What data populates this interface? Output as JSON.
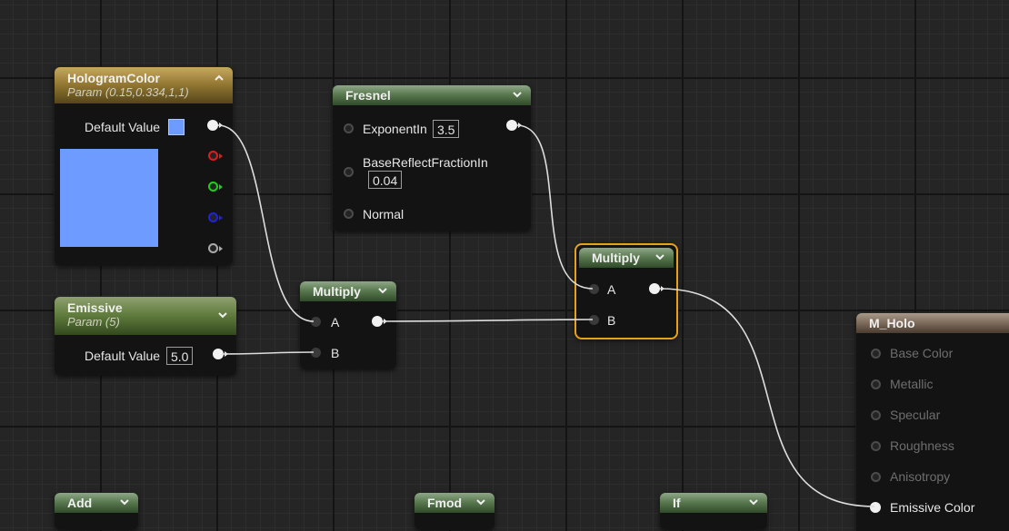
{
  "nodes": {
    "hologram_color": {
      "title": "HologramColor",
      "subtitle": "Param (0.15,0.334,1,1)",
      "default_label": "Default Value",
      "swatch_color": "#6e9bff",
      "channel_colors": [
        "#f2f2f2",
        "#e01c1c",
        "#1cd11c",
        "#2222dd",
        "#aaaaaa"
      ]
    },
    "emissive": {
      "title": "Emissive",
      "subtitle": "Param (5)",
      "default_label": "Default Value",
      "default_value": "5.0"
    },
    "fresnel": {
      "title": "Fresnel",
      "exponent_label": "ExponentIn",
      "exponent_value": "3.5",
      "base_reflect_label": "BaseReflectFractionIn",
      "base_reflect_value": "0.04",
      "normal_label": "Normal"
    },
    "multiply_1": {
      "title": "Multiply",
      "a_label": "A",
      "b_label": "B"
    },
    "multiply_2": {
      "title": "Multiply",
      "a_label": "A",
      "b_label": "B",
      "selected": true,
      "selection_color": "#e8a21a"
    },
    "material": {
      "title": "M_Holo",
      "inputs": [
        "Base Color",
        "Metallic",
        "Specular",
        "Roughness",
        "Anisotropy",
        "Emissive Color"
      ]
    },
    "add": {
      "title": "Add"
    },
    "fmod": {
      "title": "Fmod"
    },
    "if": {
      "title": "If"
    }
  }
}
